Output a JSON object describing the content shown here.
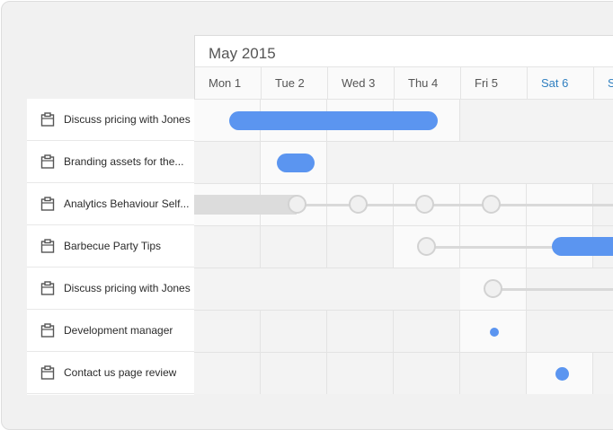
{
  "calendar": {
    "month_label": "May 2015",
    "days": [
      {
        "label": "Mon 1",
        "weekend": false
      },
      {
        "label": "Tue 2",
        "weekend": false
      },
      {
        "label": "Wed 3",
        "weekend": false
      },
      {
        "label": "Thu 4",
        "weekend": false
      },
      {
        "label": "Fri 5",
        "weekend": false
      },
      {
        "label": "Sat 6",
        "weekend": true
      },
      {
        "label": "Su",
        "weekend": true
      }
    ]
  },
  "tasks": [
    {
      "label": "Discuss pricing with Jones",
      "icon": "clipboard-icon"
    },
    {
      "label": "Branding assets for the...",
      "icon": "clipboard-icon"
    },
    {
      "label": "Analytics Behaviour Self...",
      "icon": "clipboard-icon"
    },
    {
      "label": "Barbecue Party Tips",
      "icon": "clipboard-icon"
    },
    {
      "label": "Discuss pricing with Jones",
      "icon": "clipboard-icon"
    },
    {
      "label": "Development manager",
      "icon": "clipboard-icon"
    },
    {
      "label": "Contact us page review",
      "icon": "clipboard-icon"
    }
  ],
  "colors": {
    "accent": "#5b95f0",
    "weekend_text": "#2f7fc0",
    "track": "#d9d9d9"
  }
}
